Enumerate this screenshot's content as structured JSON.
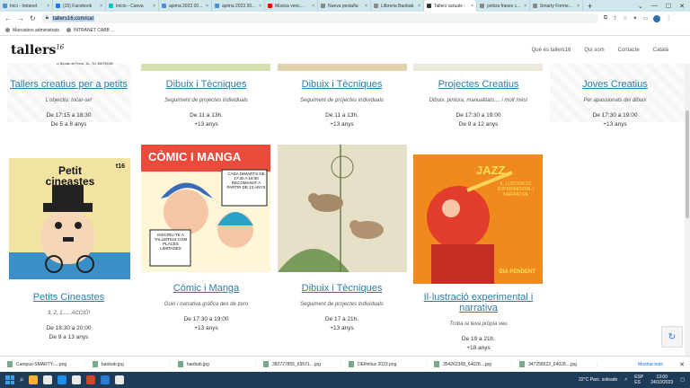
{
  "browser": {
    "tabs": [
      {
        "title": "Inici - Intranet",
        "color": "#4a90d9",
        "active": false
      },
      {
        "title": "(15) Facebook",
        "color": "#1877f2",
        "active": false
      },
      {
        "title": "Inicio - Canva",
        "color": "#00c4cc",
        "active": false
      },
      {
        "title": "apima 2023 20...",
        "color": "#4a90d9",
        "active": false
      },
      {
        "title": "apima 2023 20...",
        "color": "#4a90d9",
        "active": false
      },
      {
        "title": "Música venc...",
        "color": "#ff0000",
        "active": false
      },
      {
        "title": "Nueva pestaña",
        "color": "#888888",
        "active": false
      },
      {
        "title": "Llibreria Baobab",
        "color": "#888888",
        "active": false
      },
      {
        "title": "Tallers actuals -",
        "color": "#333333",
        "active": true
      },
      {
        "title": "policia frases c...",
        "color": "#888888",
        "active": false
      },
      {
        "title": "Smarty Forme...",
        "color": "#888888",
        "active": false
      }
    ],
    "new_tab": "+",
    "window_controls": [
      "⌄",
      "—",
      "☐",
      "✕"
    ],
    "url": "tallers16.com/ca/",
    "nav": {
      "back": "←",
      "forward": "→",
      "reload": "↻"
    },
    "bookmarks": [
      {
        "label": "Marcadors administrats"
      },
      {
        "label": "INTRANET CABB ..."
      }
    ]
  },
  "site": {
    "logo_text": "tallers",
    "logo_num": "16",
    "subaddress": "c/ Nicolau de Porcs, 16 - Tel. 656799289",
    "menu": [
      "Què és tallers16",
      "Qui som",
      "Contacte",
      "Català"
    ]
  },
  "cards_top": [
    {
      "title": "Tallers creatius per a petits",
      "subtitle": "L'objectiu: tocar-se!",
      "line1": "De 17:15 a 18:30",
      "line2": "De 5 a 8 anys"
    },
    {
      "title": "Dibuix i Tècniques",
      "subtitle": "Seguiment de projectes individuals",
      "line1": "De 11 a 13h.",
      "line2": "+13 anys"
    },
    {
      "title": "Dibuix i Tècniques",
      "subtitle": "Seguiment de projectes individuals",
      "line1": "De 11 a 13h.",
      "line2": "+13 anys"
    },
    {
      "title": "Projectes Creatius",
      "subtitle": "Dibuix, pintura, manualitats.... i molt més!",
      "line1": "De 17:30 a 19:00",
      "line2": "De 9 a 12 anys"
    },
    {
      "title": "Joves Creatius",
      "subtitle": "Per apassionats del dibuix",
      "line1": "De 17:30 a 19:00",
      "line2": "+13 anys"
    }
  ],
  "posters": [
    {
      "heading": "Petit cineastes",
      "tag": "t16",
      "colors": [
        "#3b8fc7",
        "#f2e3a3"
      ]
    },
    {
      "heading": "CÒMIC I MANGA",
      "tag": "CADA DIMARTS DE 17:30 A 19:00 RECOMANAT A PARTIR DE 13 ANYS",
      "note": "INSCRIU-TE A TALLERS16.COM PLACES LIMITADES",
      "colors": [
        "#e94c3a",
        "#f7d34a"
      ]
    },
    {
      "heading": "",
      "tag": "",
      "colors": [
        "#9fb98a",
        "#e7e0c9"
      ]
    },
    {
      "heading": "JAZZ",
      "tag": "IL·LUSTRACIÓ EXPERIMENTAL I NARRATIVA",
      "note": "DIA PENDENT",
      "colors": [
        "#f08a1c",
        "#e23c2c"
      ]
    }
  ],
  "cards_bottom": [
    {
      "title": "Petits Cineastes",
      "subtitle": "3, 2, 1..... ACCIÓ!",
      "line1": "De 18:30 a 20:00",
      "line2": "De 9 a 13 anys"
    },
    {
      "title": "Còmic i Manga",
      "subtitle": "Guió i narrativa gràfica des de zero",
      "line1": "De 17:30 a 19:00",
      "line2": "+13 anys"
    },
    {
      "title": "Dibuix i Tècniques",
      "subtitle": "Seguiment de projectes individuals",
      "line1": "De 17 a 21h.",
      "line2": "+13 anys"
    },
    {
      "title": "Il·lustració experimental i narrativa",
      "subtitle": "Troba la teva pròpia veu",
      "line1": "De 19 a 21h.",
      "line2": "+18 anys"
    }
  ],
  "downloads": {
    "files": [
      "Campus-SMARTY-....png",
      "baobab.jpg",
      "baobab.jpg",
      "382727855_69571....jpg",
      "DEfinitius 2023.png",
      "354262368_64028....jpg",
      "347258522_64028....jpg"
    ],
    "show_all": "Mostrar todo",
    "close": "✕"
  },
  "taskbar": {
    "weather": "22°C  Parc. soleado",
    "lang": "ESP\nES",
    "time": "13:00",
    "date": "24/10/2023"
  }
}
